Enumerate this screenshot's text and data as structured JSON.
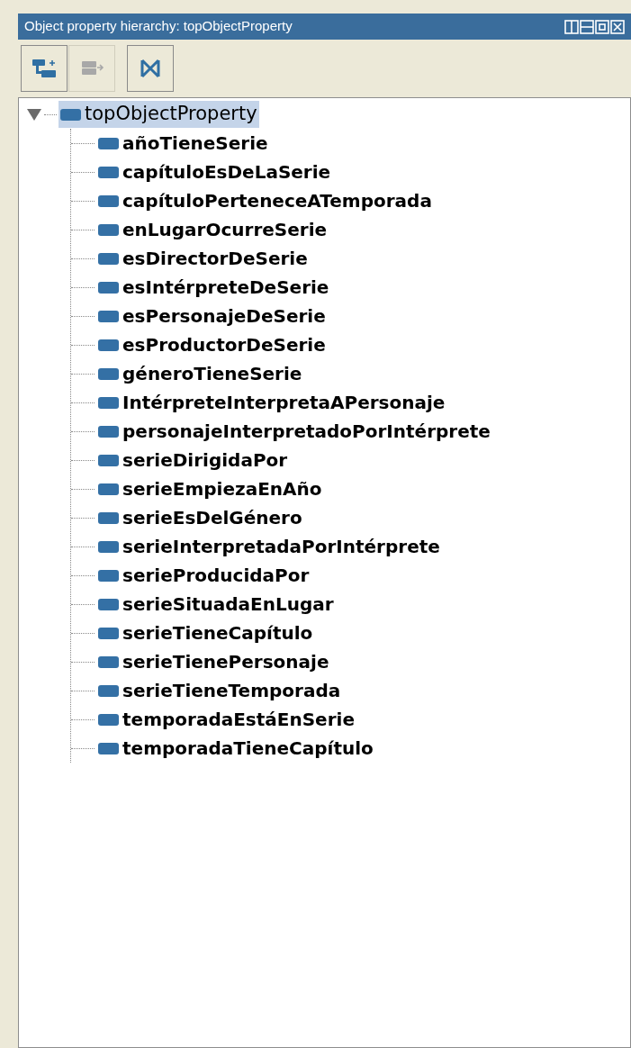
{
  "panel": {
    "title": "Object property hierarchy: topObjectProperty"
  },
  "toolbar": [
    {
      "kind": "add-sub",
      "disabled": false
    },
    {
      "kind": "add-sibling",
      "disabled": true
    },
    {
      "kind": "delete",
      "disabled": false
    }
  ],
  "tree": {
    "label": "topObjectProperty",
    "selected": true,
    "expanded": true,
    "children": [
      {
        "label": "añoTieneSerie",
        "selected": false
      },
      {
        "label": "capítuloEsDeLaSerie",
        "selected": false
      },
      {
        "label": "capítuloPerteneceATemporada",
        "selected": false
      },
      {
        "label": "enLugarOcurreSerie",
        "selected": false
      },
      {
        "label": "esDirectorDeSerie",
        "selected": false
      },
      {
        "label": "esIntérpreteDeSerie",
        "selected": false
      },
      {
        "label": "esPersonajeDeSerie",
        "selected": false
      },
      {
        "label": "esProductorDeSerie",
        "selected": false
      },
      {
        "label": "géneroTieneSerie",
        "selected": false
      },
      {
        "label": "IntérpreteInterpretaAPersonaje",
        "selected": false
      },
      {
        "label": "personajeInterpretadoPorIntérprete",
        "selected": false
      },
      {
        "label": "serieDirigidaPor",
        "selected": false
      },
      {
        "label": "serieEmpiezaEnAño",
        "selected": false
      },
      {
        "label": "serieEsDelGénero",
        "selected": false
      },
      {
        "label": "serieInterpretadaPorIntérprete",
        "selected": false
      },
      {
        "label": "serieProducidaPor",
        "selected": false
      },
      {
        "label": "serieSituadaEnLugar",
        "selected": false
      },
      {
        "label": "serieTieneCapítulo",
        "selected": false
      },
      {
        "label": "serieTienePersonaje",
        "selected": false
      },
      {
        "label": "serieTieneTemporada",
        "selected": false
      },
      {
        "label": "temporadaEstáEnSerie",
        "selected": false
      },
      {
        "label": "temporadaTieneCapítulo",
        "selected": false
      }
    ]
  }
}
